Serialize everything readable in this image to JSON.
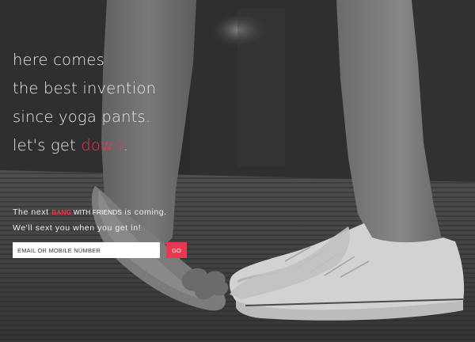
{
  "hero": {
    "lines": [
      "here comes",
      "the best invention",
      "since yoga pants."
    ],
    "last_line_prefix": "let's get ",
    "last_line_accent": "down",
    "last_line_suffix": "."
  },
  "tagline": {
    "prefix": "The next ",
    "brand_bold": "BANG",
    "brand_rest": "WITH FRIENDS",
    "suffix": " is coming.",
    "line2": "We'll sext you when you get in!"
  },
  "signup": {
    "placeholder": "EMAIL OR MOBILE NUMBER",
    "button_label": "GO"
  },
  "colors": {
    "accent": "#e8384f",
    "text": "#e9e9e9"
  }
}
